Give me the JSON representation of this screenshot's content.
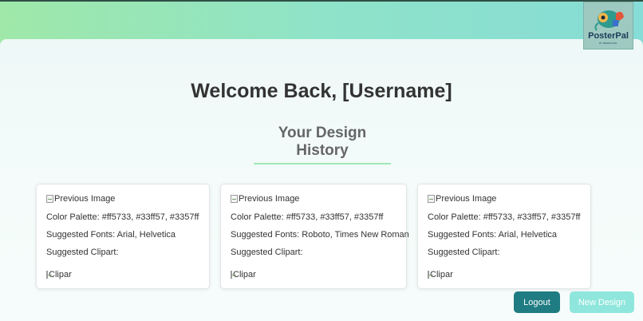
{
  "header": {
    "logo_text": "PosterPal",
    "logo_tagline": "BY DESIGN PAL"
  },
  "main": {
    "title": "Welcome Back, [Username]",
    "section_title": "Your Design History"
  },
  "cards": [
    {
      "image_alt": "Previous Image",
      "color_palette": "Color Palette: #ff5733, #33ff57, #3357ff",
      "fonts": "Suggested Fonts: Arial, Helvetica",
      "clipart_label": "Suggested Clipart:",
      "clipart_alt": "Clipart"
    },
    {
      "image_alt": "Previous Image",
      "color_palette": "Color Palette: #ff5733, #33ff57, #3357ff",
      "fonts": "Suggested Fonts: Roboto, Times New Roman",
      "clipart_label": "Suggested Clipart:",
      "clipart_alt": "Clipart"
    },
    {
      "image_alt": "Previous Image",
      "color_palette": "Color Palette: #ff5733, #33ff57, #3357ff",
      "fonts": "Suggested Fonts: Arial, Helvetica",
      "clipart_label": "Suggested Clipart:",
      "clipart_alt": "Clipart"
    }
  ],
  "actions": {
    "logout_label": "Logout",
    "new_design_label": "New Design"
  },
  "colors": {
    "header_gradient_start": "#9fe8a9",
    "header_gradient_end": "#86dcd6",
    "logout_button": "#1f7c82",
    "new_design_button": "#8fe6dc",
    "section_underline": "#9fe8b5"
  }
}
